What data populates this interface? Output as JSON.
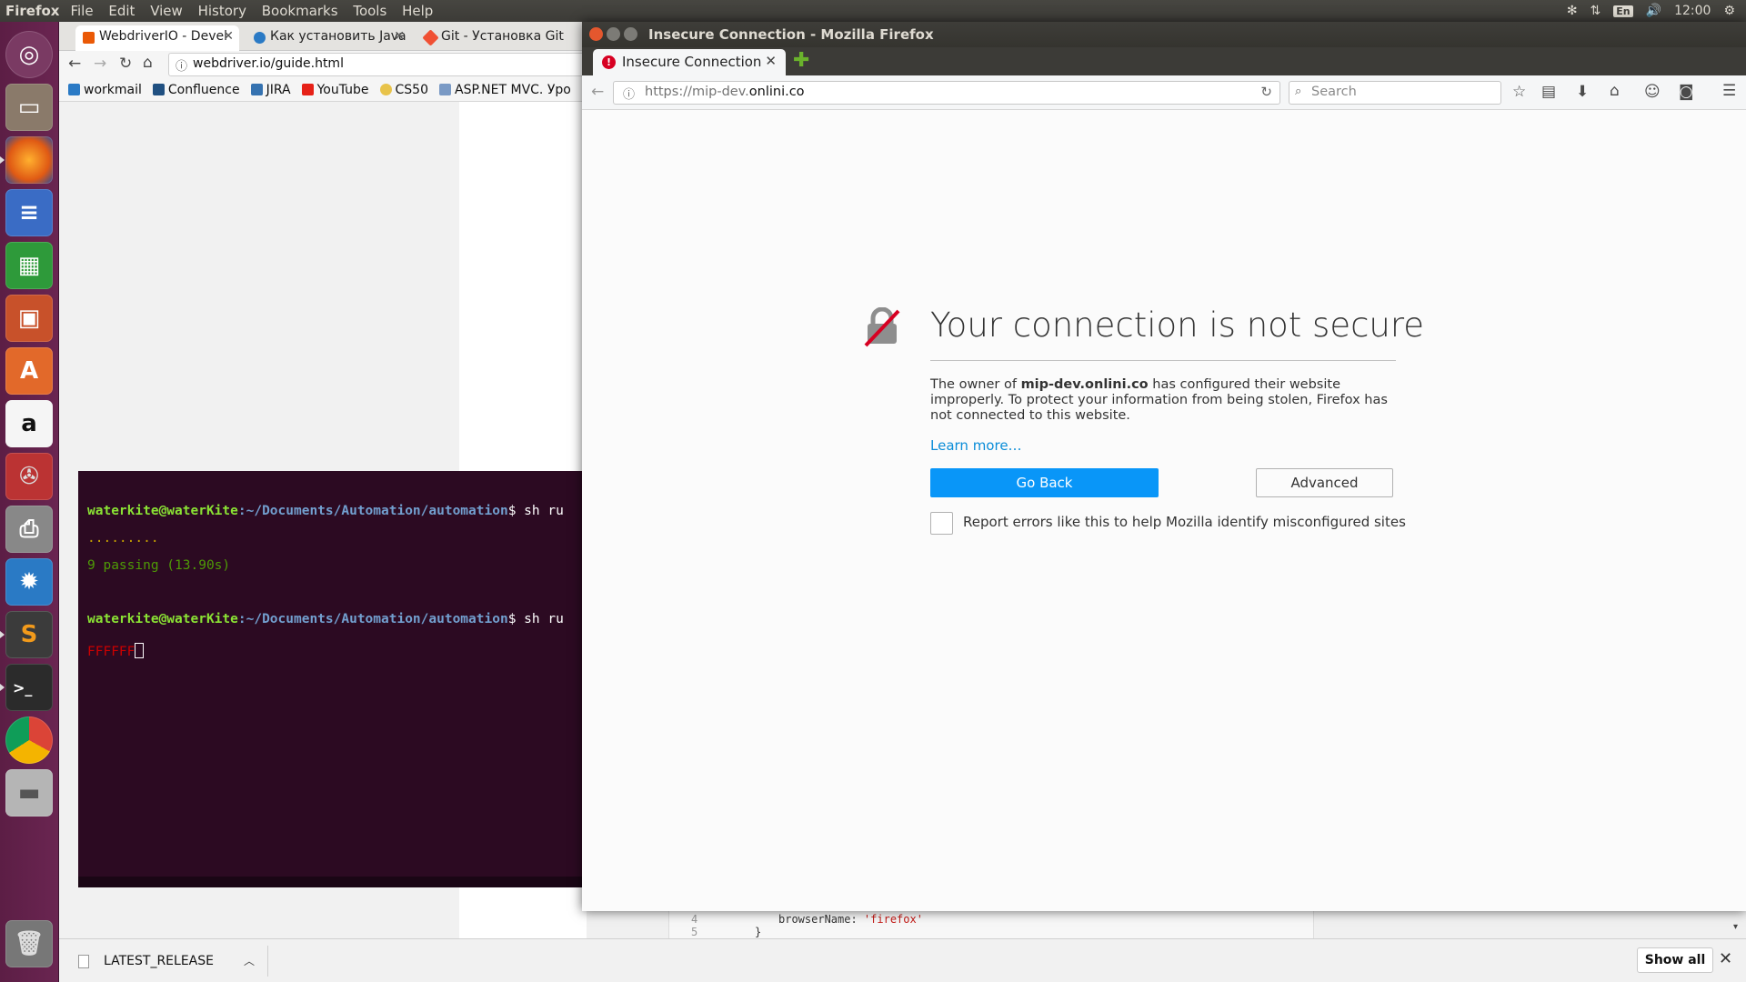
{
  "topbar": {
    "app_name": "Firefox",
    "menu": [
      "File",
      "Edit",
      "View",
      "History",
      "Bookmarks",
      "Tools",
      "Help"
    ],
    "keyboard_layout": "En",
    "clock": "12:00"
  },
  "launcher": {
    "items": [
      "ubuntu-dash",
      "files",
      "firefox",
      "libreoffice-writer",
      "libreoffice-calc",
      "libreoffice-impress",
      "ubuntu-software",
      "amazon",
      "system-settings",
      "printer",
      "unity-tweak",
      "sublime-text",
      "terminal",
      "chrome",
      "disk",
      "trash"
    ]
  },
  "background_browser": {
    "tabs": [
      {
        "label": "WebdriverIO - Devel"
      },
      {
        "label": "Как установить Java"
      },
      {
        "label": "Git - Установка Git"
      }
    ],
    "url": "webdriver.io/guide.html",
    "bookmarks": [
      "workmail",
      "Confluence",
      "JIRA",
      "YouTube",
      "CS50",
      "ASP.NET MVC. Уро"
    ],
    "code_peek": {
      "line_number": "4",
      "line_number_next": "5",
      "code_key": "browserName: ",
      "code_value": "'firefox'",
      "code_next": "}"
    }
  },
  "terminal": {
    "line1_user": "waterkite@waterKite",
    "line1_path": ":~/Documents/Automation/automation",
    "line1_cmd": "$ sh ru",
    "line2_dots": ".........",
    "line3_result": "9 passing (13.90s)",
    "line4_user": "waterkite@waterKite",
    "line4_path": ":~/Documents/Automation/automation",
    "line4_cmd": "$ sh ru",
    "line5_fails": "FFFFFF"
  },
  "firefox": {
    "window_title": "Insecure Connection - Mozilla Firefox",
    "tab_label": "Insecure Connection",
    "url_scheme": "https://mip-dev.",
    "url_host": "onlini.co",
    "search_placeholder": "Search",
    "error": {
      "title": "Your connection is not secure",
      "desc_prefix": "The owner of ",
      "desc_host": "mip-dev.onlini.co",
      "desc_suffix": " has configured their website improperly. To protect your information from being stolen, Firefox has not connected to this website.",
      "learn_more": "Learn more…",
      "go_back": "Go Back",
      "advanced": "Advanced",
      "report_label": "Report errors like this to help Mozilla identify misconfigured sites",
      "report_checked": false
    }
  },
  "downloads": {
    "file_name": "LATEST_RELEASE",
    "show_all": "Show all"
  },
  "colors": {
    "launcher": "#6a2551",
    "terminal_bg": "#2c0a22",
    "go_back_blue": "#0996f8",
    "prompt_green": "#8ae234",
    "path_blue": "#729fcf",
    "fail_red": "#cc0000"
  }
}
